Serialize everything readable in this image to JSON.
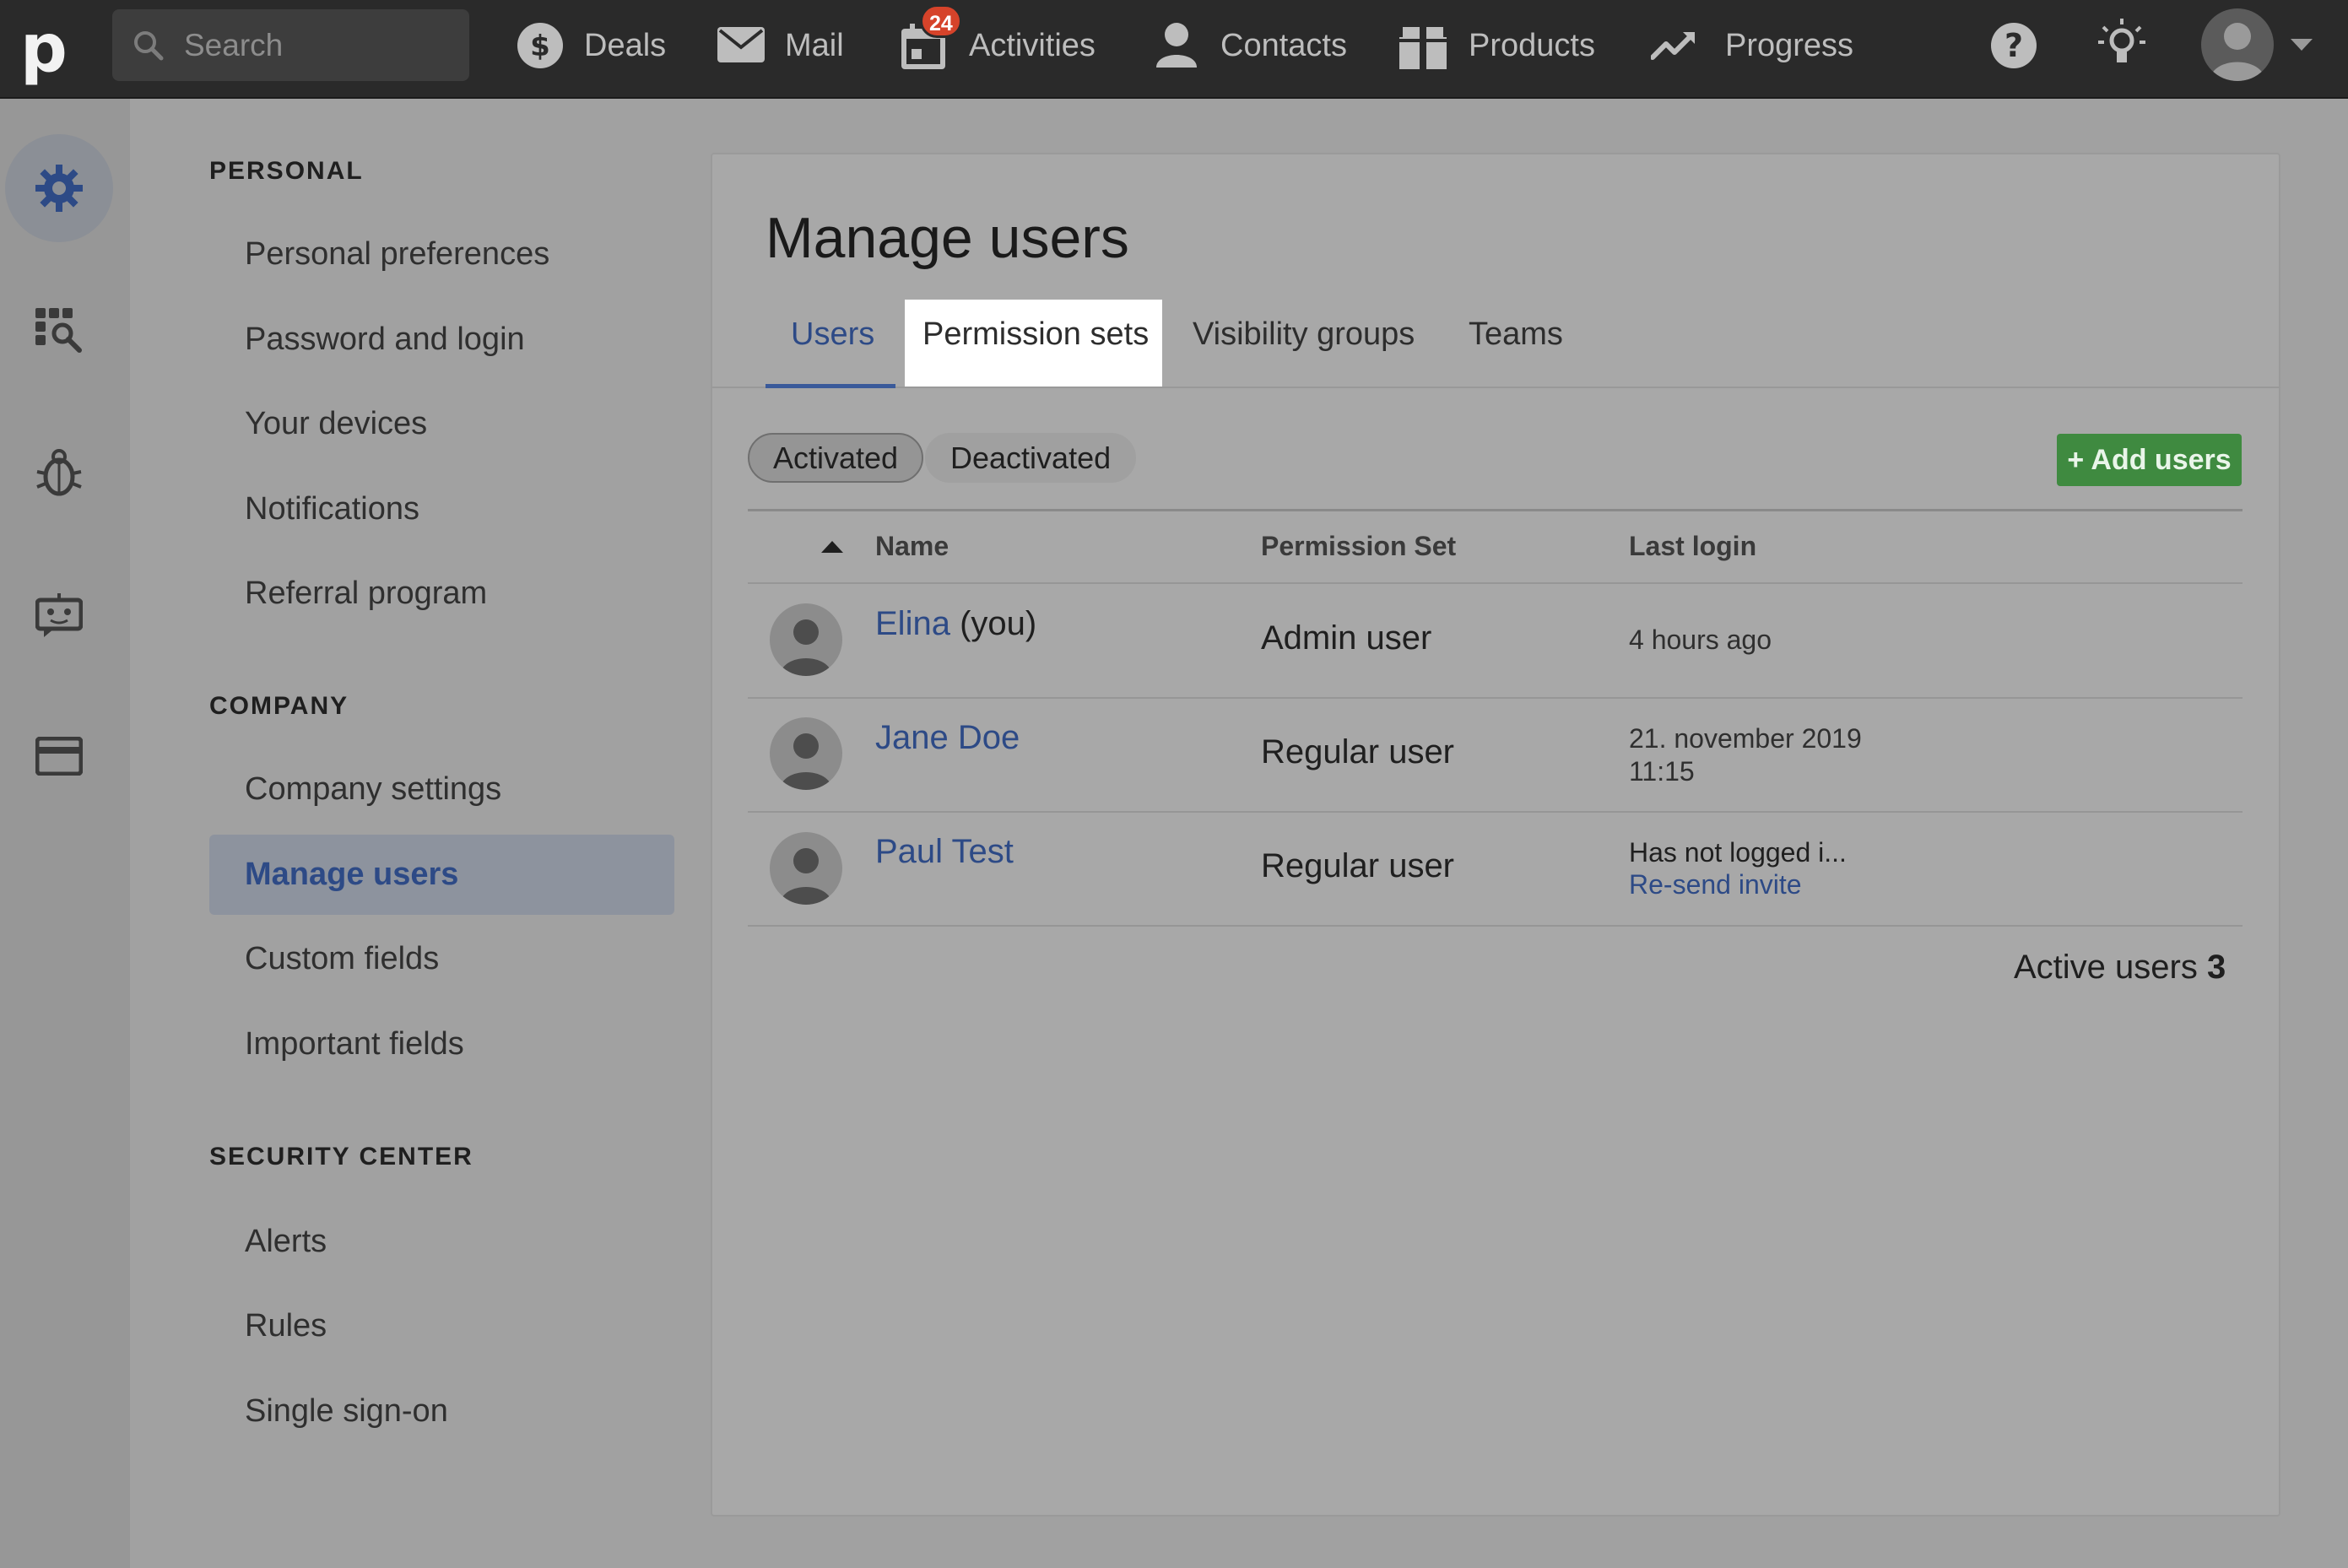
{
  "topbar": {
    "search_placeholder": "Search",
    "nav": [
      {
        "label": "Deals",
        "icon": "dollar-icon"
      },
      {
        "label": "Mail",
        "icon": "mail-icon"
      },
      {
        "label": "Activities",
        "icon": "calendar-icon",
        "badge": "24"
      },
      {
        "label": "Contacts",
        "icon": "contacts-icon"
      },
      {
        "label": "Products",
        "icon": "products-icon"
      },
      {
        "label": "Progress",
        "icon": "progress-icon"
      }
    ],
    "right_icons": [
      "help-icon",
      "lightbulb-icon",
      "avatar",
      "chevron-down-icon"
    ]
  },
  "rail": {
    "items": [
      "gear-icon",
      "grid-search-icon",
      "bug-icon",
      "chat-bot-icon",
      "credit-card-icon"
    ]
  },
  "sidebar": {
    "personal": {
      "heading": "PERSONAL",
      "items": [
        "Personal preferences",
        "Password and login",
        "Your devices",
        "Notifications",
        "Referral program"
      ]
    },
    "company": {
      "heading": "COMPANY",
      "items": [
        "Company settings",
        "Manage users",
        "Custom fields",
        "Important fields"
      ]
    },
    "security": {
      "heading": "SECURITY CENTER",
      "items": [
        "Alerts",
        "Rules",
        "Single sign-on"
      ]
    }
  },
  "main": {
    "title": "Manage users",
    "tabs": [
      "Users",
      "Permission sets",
      "Visibility groups",
      "Teams"
    ],
    "filters": {
      "activated": "Activated",
      "deactivated": "Deactivated"
    },
    "add_button": "+ Add users",
    "columns": {
      "name": "Name",
      "permission": "Permission Set",
      "last_login": "Last login"
    },
    "rows": [
      {
        "name": "Elina",
        "suffix": "(you)",
        "permission": "Admin user",
        "last_login": "4 hours ago"
      },
      {
        "name": "Jane Doe",
        "permission": "Regular user",
        "last_login_line1": "21. november 2019",
        "last_login_line2": "11:15"
      },
      {
        "name": "Paul Test",
        "permission": "Regular user",
        "last_login": "Has not logged i...",
        "resend": "Re-send invite"
      }
    ],
    "active_users_label": "Active users",
    "active_users_count": "3"
  },
  "colors": {
    "topbar": "#2a2a2a",
    "link_blue": "#2d4a86",
    "add_green": "#3f8a40",
    "badge_red": "#d6432a"
  }
}
